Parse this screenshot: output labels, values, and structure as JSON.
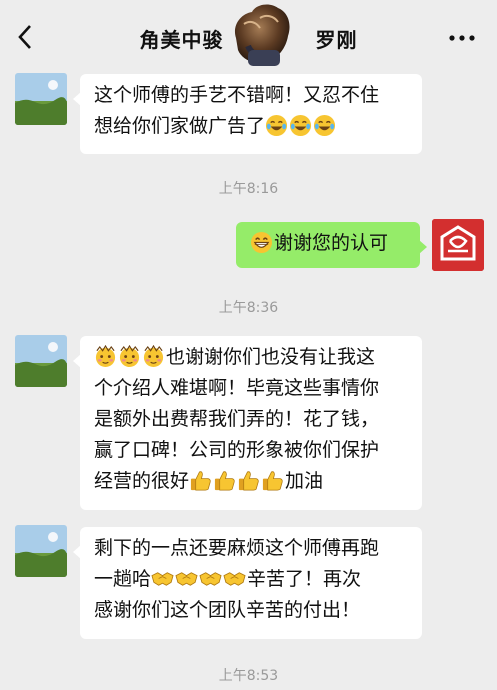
{
  "header": {
    "title_left": "角美中骏",
    "title_right": "罗刚",
    "back_icon": "chevron-left-icon",
    "more_icon": "more-dots-icon"
  },
  "messages": [
    {
      "side": "left",
      "lines": [
        "这个师傅的手艺不错啊！又忍不住",
        "想给你们家做广告了"
      ],
      "emojis": [
        "crying-laughing",
        "crying-laughing",
        "crying-laughing"
      ]
    },
    {
      "side": "right",
      "text": "谢谢您的认可",
      "emojis": [
        "grin"
      ]
    },
    {
      "side": "left",
      "lines": [
        "也谢谢你们也没有让我这",
        "个介绍人难堪啊！毕竟这些事情你",
        "是额外出费帮我们弄的！花了钱，",
        "赢了口碑！公司的形象被你们保护",
        "经营的很好",
        "加油"
      ],
      "emojis": [
        "shy-face",
        "shy-face",
        "shy-face",
        "thumbs-up",
        "thumbs-up",
        "thumbs-up",
        "thumbs-up"
      ]
    },
    {
      "side": "left",
      "lines": [
        "剩下的一点还要麻烦这个师傅再跑",
        "一趟哈",
        "辛苦了！再次",
        "感谢你们这个团队辛苦的付出！"
      ],
      "emojis": [
        "handshake",
        "handshake",
        "handshake",
        "handshake"
      ]
    }
  ],
  "timestamps": [
    "上午8:16",
    "上午8:36",
    "上午8:53"
  ],
  "colors": {
    "background": "#ededed",
    "bubble_left": "#ffffff",
    "bubble_right": "#95ec69",
    "timestamp": "#9a9a9a",
    "avatar_right": "#c62828"
  }
}
